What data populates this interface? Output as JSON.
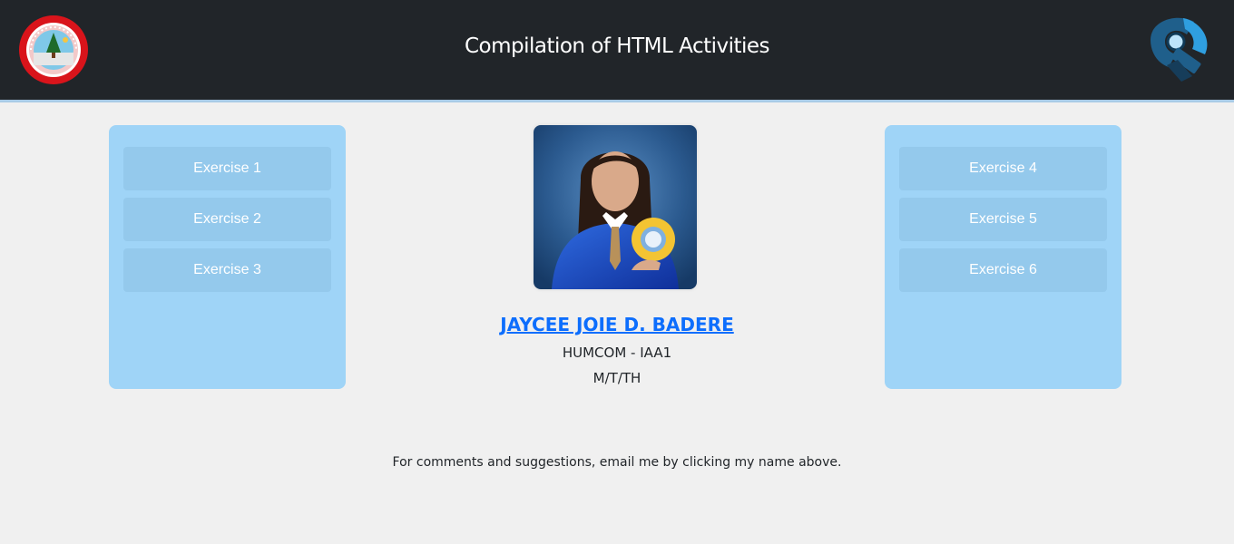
{
  "header": {
    "title": "Compilation of HTML Activities",
    "left_logo_icon": "university-seal-icon",
    "right_logo_icon": "brand-logo-icon"
  },
  "left_panel": {
    "buttons": [
      {
        "label": "Exercise 1"
      },
      {
        "label": "Exercise 2"
      },
      {
        "label": "Exercise 3"
      }
    ]
  },
  "right_panel": {
    "buttons": [
      {
        "label": "Exercise 4"
      },
      {
        "label": "Exercise 5"
      },
      {
        "label": "Exercise 6"
      }
    ]
  },
  "profile": {
    "photo_icon": "profile-photo",
    "name": "JAYCEE JOIE D. BADERE",
    "course": "HUMCOM - IAA1",
    "schedule": "M/T/TH"
  },
  "footer": {
    "note": "For comments and suggestions, email me by clicking my name above."
  },
  "colors": {
    "header_bg": "#212529",
    "page_bg": "#f0f0f0",
    "panel_bg": "#9fd4f7",
    "button_bg": "#94c9ec",
    "link": "#0d6efd"
  }
}
